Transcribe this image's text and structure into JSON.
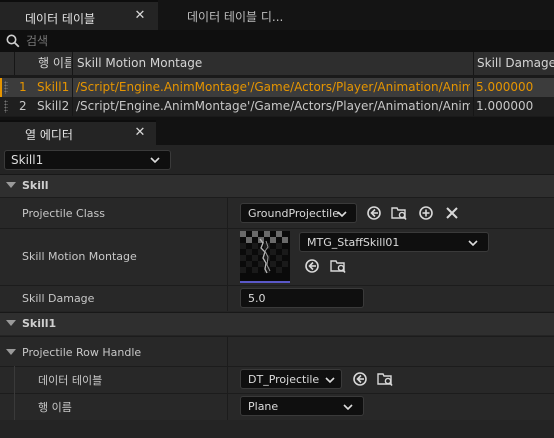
{
  "tabs": [
    {
      "label": "데이터 테이블",
      "close": "✕"
    },
    {
      "label": "데이터 테이블 디..."
    }
  ],
  "search": {
    "placeholder": "검색"
  },
  "table": {
    "columns": [
      "",
      "행 이름",
      "Skill Motion Montage",
      "Skill Damage"
    ],
    "rows": [
      {
        "index": "1",
        "name": "Skill1",
        "montage": "/Script/Engine.AnimMontage'/Game/Actors/Player/Animation/Anim_Sta",
        "damage": "5.000000",
        "selected": true
      },
      {
        "index": "2",
        "name": "Skill2",
        "montage": "/Script/Engine.AnimMontage'/Game/Actors/Player/Animation/Anim_Sta",
        "damage": "1.000000",
        "selected": false
      }
    ]
  },
  "editor": {
    "tab_label": "열 에디터",
    "close": "✕",
    "row_select": "Skill1",
    "categories": {
      "skill": "Skill",
      "skill1": "Skill1"
    },
    "properties": {
      "projectile_class": {
        "label": "Projectile Class",
        "value": "GroundProjectile"
      },
      "skill_motion_montage": {
        "label": "Skill Motion Montage",
        "value": "MTG_StaffSkill01"
      },
      "skill_damage": {
        "label": "Skill Damage",
        "value": "5.0"
      },
      "projectile_row_handle": {
        "label": "Projectile Row Handle"
      },
      "data_table": {
        "label": "데이터 테이블",
        "value": "DT_Projectile"
      },
      "row_name": {
        "label": "행 이름",
        "value": "Plane"
      }
    }
  },
  "colors": {
    "accent_orange": "#e69500",
    "selection_bg": "#3c3c3c",
    "panel_bg": "#242424"
  }
}
